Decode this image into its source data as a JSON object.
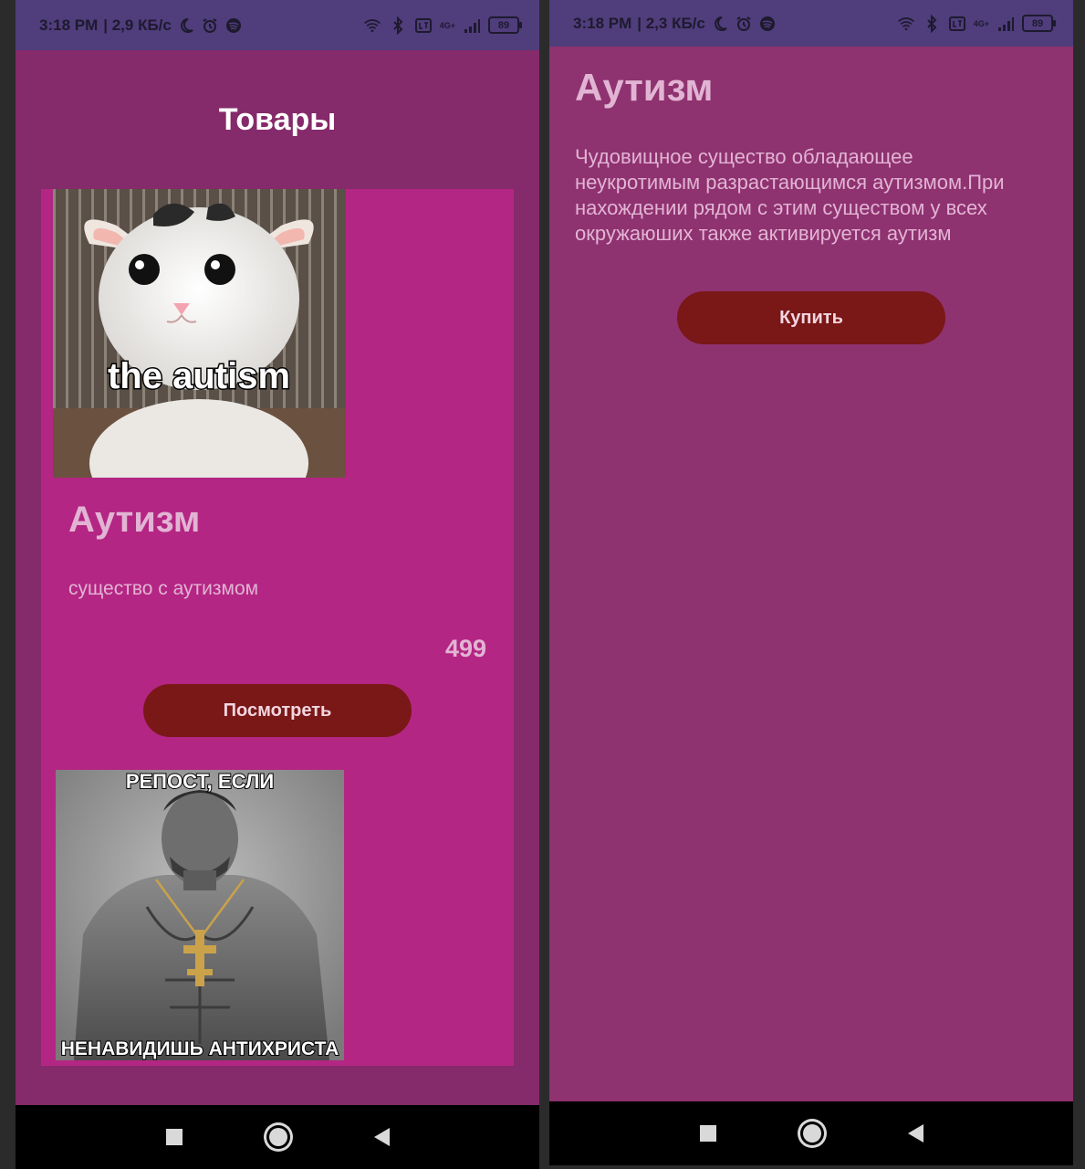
{
  "left_screen": {
    "status": {
      "time": "3:18 PM",
      "speed": "| 2,9 КБ/с",
      "network": "4G+",
      "battery": "89"
    },
    "appbar_title": "Товары",
    "products": [
      {
        "image_caption": "the autism",
        "title": "Аутизм",
        "description": "существо с аутизмом",
        "price": "499",
        "view_button": "Посмотреть"
      },
      {
        "image_caption_top": "РЕПОСТ, ЕСЛИ",
        "image_caption_bottom": "НЕНАВИДИШЬ АНТИХРИСТА"
      }
    ]
  },
  "right_screen": {
    "status": {
      "time": "3:18 PM",
      "speed": "| 2,3 КБ/с",
      "network": "4G+",
      "battery": "89"
    },
    "title": "Аутизм",
    "description": "Чудовищное существо обладающее неукротимым разрастающимся аутизмом.При нахождении рядом с этим существом у всех окружаюших также активируется аутизм",
    "buy_button": "Купить"
  },
  "icons": {
    "status_left": [
      "moon-icon",
      "alarm-icon",
      "spotify-icon"
    ],
    "status_right": [
      "wifi-icon",
      "bluetooth-icon",
      "volte-icon",
      "signal-icon",
      "battery-icon"
    ],
    "nav": [
      "recents-icon",
      "home-icon",
      "back-icon"
    ]
  },
  "colors": {
    "status_bar": "#4f3d7c",
    "screen_bg": "#852a6a",
    "card_bg": "#b42683",
    "button_bg": "#7a1717",
    "text_light": "#e2b4d4"
  }
}
